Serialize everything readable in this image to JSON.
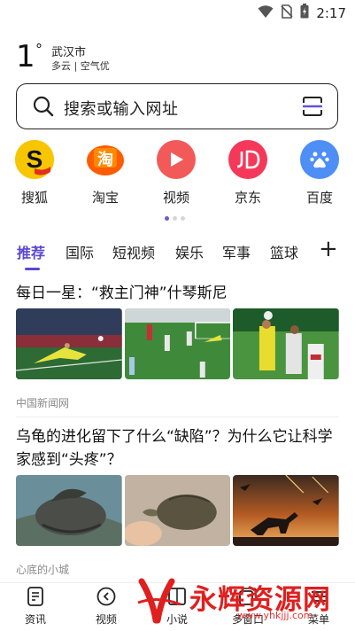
{
  "status_bar": {
    "time": "2:17"
  },
  "weather": {
    "temperature": "1",
    "degree_symbol": "°",
    "city": "武汉市",
    "condition": "多云 | 空气优"
  },
  "search": {
    "placeholder": "搜索或输入网址"
  },
  "shortcuts": [
    {
      "label": "搜狐",
      "icon": "sohu-logo-icon",
      "color": "#f7c600"
    },
    {
      "label": "淘宝",
      "icon": "taobao-logo-icon",
      "color": "#ff5b00"
    },
    {
      "label": "视频",
      "icon": "video-play-icon",
      "color": "#f25a5a"
    },
    {
      "label": "京东",
      "icon": "jd-logo-icon",
      "color": "#f5385a"
    },
    {
      "label": "百度",
      "icon": "baidu-paw-icon",
      "color": "#4e8ff6"
    }
  ],
  "page_indicator": {
    "count": 3,
    "active": 0
  },
  "tabs": [
    "推荐",
    "国际",
    "短视频",
    "娱乐",
    "军事",
    "篮球"
  ],
  "active_tab": "推荐",
  "news": [
    {
      "title": "每日一星：“救主门神”什琴斯尼",
      "source": "中国新闻网"
    },
    {
      "title": "乌龟的进化留下了什么“缺陷”？为什么它让科学家感到“头疼”？",
      "source": "心底的小城"
    }
  ],
  "bottom_nav": [
    {
      "label": "资讯",
      "icon": "news-doc-icon"
    },
    {
      "label": "视频",
      "icon": "video-circle-icon"
    },
    {
      "label": "小说",
      "icon": "book-icon"
    },
    {
      "label": "多窗口",
      "icon": "windows-icon"
    },
    {
      "label": "菜单",
      "icon": "menu-icon"
    }
  ],
  "watermark": {
    "text": "永辉资源网",
    "url": "www.yhkjjj.com"
  },
  "colors": {
    "accent": "#5b47d0",
    "watermark": "#e01f1f"
  }
}
